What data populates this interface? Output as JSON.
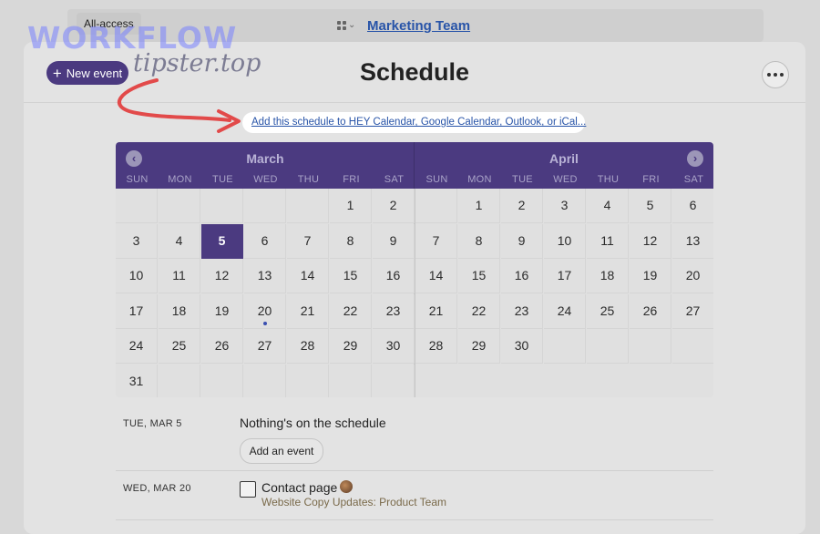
{
  "top_bar": {
    "all_access": "All-access",
    "team_name": "Marketing Team"
  },
  "header": {
    "new_event_label": "New event",
    "title": "Schedule"
  },
  "watermark": {
    "line1": "WORKFLOW",
    "line2": "tipster.top"
  },
  "calendar_link": "Add this schedule to HEY Calendar, Google Calendar, Outlook, or iCal...",
  "calendar": {
    "months": [
      "March",
      "April"
    ],
    "weekdays": [
      "SUN",
      "MON",
      "TUE",
      "WED",
      "THU",
      "FRI",
      "SAT"
    ],
    "march_first_weekday": 5,
    "march_days": 31,
    "april_first_weekday": 1,
    "april_days": 30,
    "today": "5",
    "event_dot_day": "20",
    "accent_color": "#4b3a80"
  },
  "events": [
    {
      "date": "TUE, MAR 5",
      "empty_text": "Nothing's on the schedule",
      "add_label": "Add an event"
    },
    {
      "date": "WED, MAR 20",
      "title": "Contact page",
      "subtitle": "Website Copy Updates: Product Team"
    }
  ],
  "icons": {
    "new_event": "plus-icon",
    "more": "ellipsis-icon",
    "prev": "chevron-left-icon",
    "next": "chevron-right-icon",
    "project_switcher": "grid-icon"
  }
}
